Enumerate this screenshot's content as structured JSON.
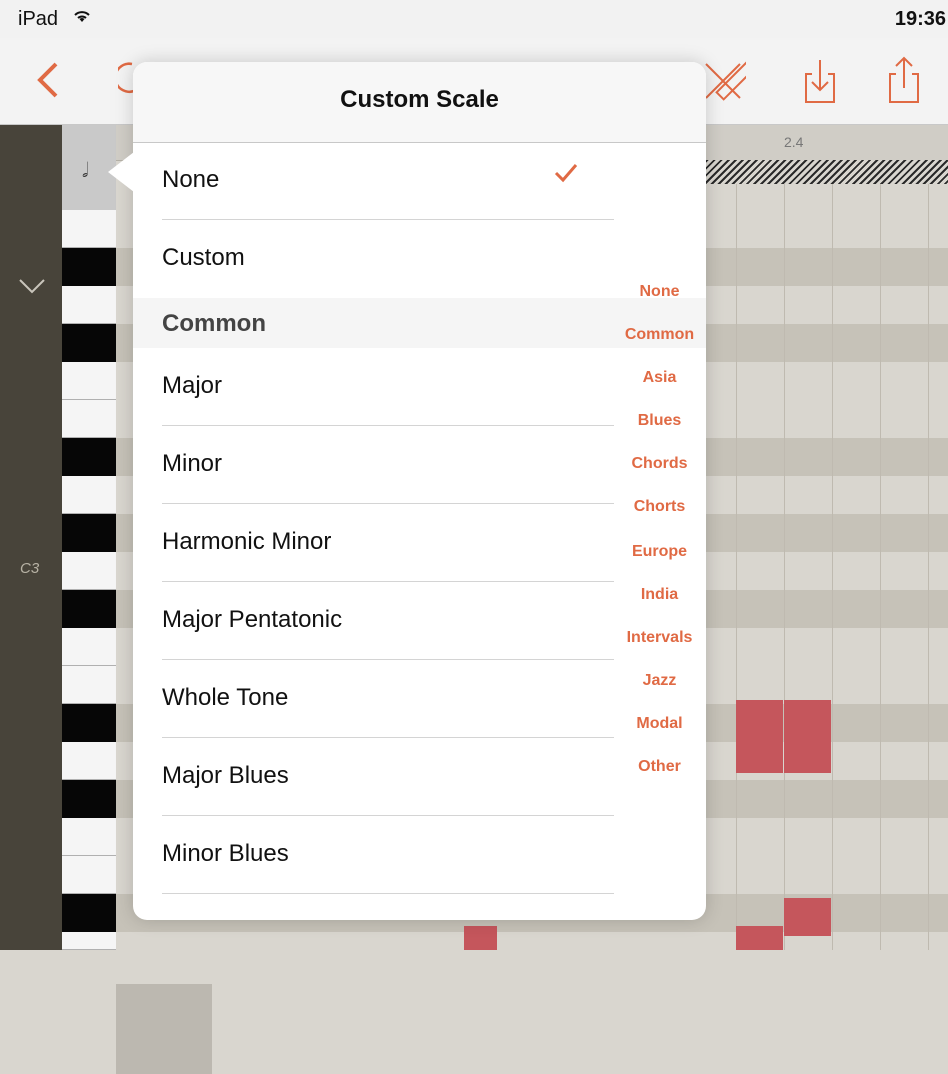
{
  "status_bar": {
    "carrier": "iPad",
    "time": "19:36"
  },
  "toolbar": {
    "icons": [
      "back-chevron-icon",
      "undo-icon",
      "ruler-pencil-icon",
      "import-icon",
      "share-icon"
    ],
    "accent_color": "#e06a44"
  },
  "editor": {
    "ruler_label": "2.4",
    "octave_label": "C3",
    "note_length_glyph": "𝅗𝅥"
  },
  "popover": {
    "title": "Custom Scale",
    "items": [
      {
        "label": "None",
        "checked": true
      },
      {
        "label": "Custom"
      }
    ],
    "section_title": "Common",
    "section_items": [
      {
        "label": "Major"
      },
      {
        "label": "Minor"
      },
      {
        "label": "Harmonic Minor"
      },
      {
        "label": "Major Pentatonic"
      },
      {
        "label": "Whole Tone"
      },
      {
        "label": "Major Blues"
      },
      {
        "label": "Minor Blues"
      }
    ],
    "index": [
      "None",
      "Common",
      "Asia",
      "Blues",
      "Chords",
      "Chorts",
      "Europe",
      "India",
      "Intervals",
      "Jazz",
      "Modal",
      "Other"
    ]
  },
  "colors": {
    "accent": "#e06a44",
    "note": "#c5565c",
    "sidebar": "#48443a"
  }
}
